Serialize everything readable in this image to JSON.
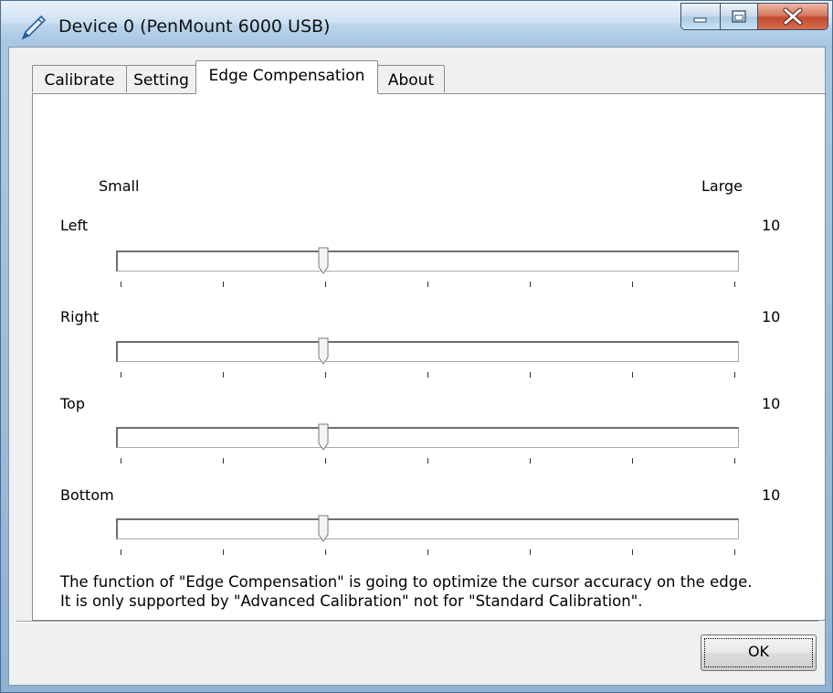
{
  "window": {
    "title": "Device 0 (PenMount 6000 USB)"
  },
  "tabs": [
    {
      "label": "Calibrate",
      "active": false
    },
    {
      "label": "Setting",
      "active": false
    },
    {
      "label": "Edge Compensation",
      "active": true
    },
    {
      "label": "About",
      "active": false
    }
  ],
  "scale": {
    "small_label": "Small",
    "large_label": "Large"
  },
  "sliders": [
    {
      "label": "Left",
      "value": "10"
    },
    {
      "label": "Right",
      "value": "10"
    },
    {
      "label": "Top",
      "value": "10"
    },
    {
      "label": "Bottom",
      "value": "10"
    }
  ],
  "slider_position_fraction": 0.333,
  "note": {
    "line1": "The function of \"Edge Compensation\" is going to optimize the cursor accuracy on the edge.",
    "line2": "It is only supported by \"Advanced Calibration\" not for \"Standard Calibration\"."
  },
  "buttons": {
    "ok": "OK"
  },
  "icons": {
    "title_icon": "pen-icon",
    "minimize": "minimize-icon",
    "maximize": "maximize-icon",
    "close": "close-icon"
  }
}
